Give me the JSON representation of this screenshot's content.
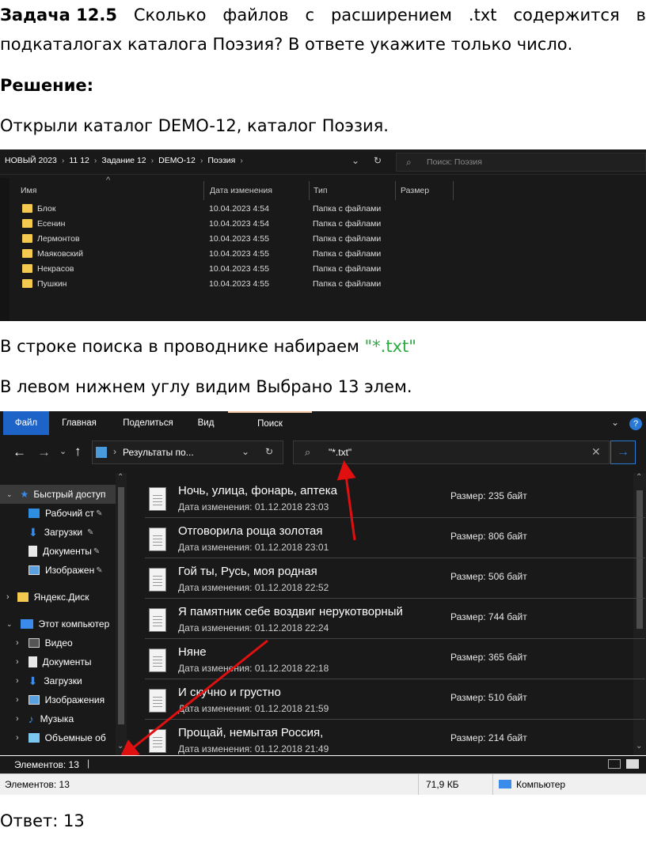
{
  "task": {
    "label": "Задача 12.5",
    "words": [
      "Сколько",
      "файлов",
      "с",
      "расширением",
      ".txt",
      "содержится",
      "в"
    ],
    "line2": "подкаталогах каталога Поэзия? В ответе укажите только число."
  },
  "solution_label": "Решение:",
  "step1": "Открыли каталог DEMO-12, каталог Поэзия.",
  "step2_prefix": "В строке поиска в проводнике набираем ",
  "step2_query": "\"*.txt\"",
  "step3": "В левом нижнем углу видим Выбрано 13 элем.",
  "answer": "Ответ: 13",
  "explorer1": {
    "breadcrumb": [
      "НОВЫЙ 2023",
      "11 12",
      "Задание 12",
      "DEMO-12",
      "Поэзия"
    ],
    "search_placeholder": "Поиск: Поэзия",
    "columns": [
      "Имя",
      "Дата изменения",
      "Тип",
      "Размер"
    ],
    "rows": [
      {
        "name": "Блок",
        "date": "10.04.2023 4:54",
        "type": "Папка с файлами"
      },
      {
        "name": "Есенин",
        "date": "10.04.2023 4:54",
        "type": "Папка с файлами"
      },
      {
        "name": "Лермонтов",
        "date": "10.04.2023 4:55",
        "type": "Папка с файлами"
      },
      {
        "name": "Маяковский",
        "date": "10.04.2023 4:55",
        "type": "Папка с файлами"
      },
      {
        "name": "Некрасов",
        "date": "10.04.2023 4:55",
        "type": "Папка с файлами"
      },
      {
        "name": "Пушкин",
        "date": "10.04.2023 4:55",
        "type": "Папка с файлами"
      }
    ],
    "colors": {
      "folder": "#f4c94f",
      "background": "#191919"
    }
  },
  "explorer2": {
    "tabs": [
      "Файл",
      "Главная",
      "Поделиться",
      "Вид",
      "Поиск"
    ],
    "address": "Результаты по...",
    "search_value": "\"*.txt\"",
    "sidebar": [
      {
        "label": "Быстрый доступ",
        "icon": "star-icon"
      },
      {
        "label": "Рабочий ст",
        "icon": "desktop-icon"
      },
      {
        "label": "Загрузки",
        "icon": "download-icon"
      },
      {
        "label": "Документы",
        "icon": "document-icon"
      },
      {
        "label": "Изображен",
        "icon": "image-icon"
      },
      {
        "label": "Яндекс.Диск",
        "icon": "yandex-disk-icon"
      },
      {
        "label": "Этот компьютер",
        "icon": "computer-icon"
      },
      {
        "label": "Видео",
        "icon": "video-icon"
      },
      {
        "label": "Документы",
        "icon": "document-icon"
      },
      {
        "label": "Загрузки",
        "icon": "download-icon"
      },
      {
        "label": "Изображения",
        "icon": "image-icon"
      },
      {
        "label": "Музыка",
        "icon": "music-icon"
      },
      {
        "label": "Объемные об",
        "icon": "cube-icon"
      }
    ],
    "results": [
      {
        "title": "Ночь, улица, фонарь, аптека",
        "date": "Дата изменения: 01.12.2018 23:03",
        "size": "Размер: 235 байт"
      },
      {
        "title": "Отговорила роща золотая",
        "date": "Дата изменения: 01.12.2018 23:01",
        "size": "Размер: 806 байт"
      },
      {
        "title": "Гой ты, Русь, моя родная",
        "date": "Дата изменения: 01.12.2018 22:52",
        "size": "Размер: 506 байт"
      },
      {
        "title": "Я памятник себе воздвиг нерукотворный",
        "date": "Дата изменения: 01.12.2018 22:24",
        "size": "Размер: 744 байт"
      },
      {
        "title": "Няне",
        "date": "Дата изменения: 01.12.2018 22:18",
        "size": "Размер: 365 байт"
      },
      {
        "title": "И скучно и грустно",
        "date": "Дата изменения: 01.12.2018 21:59",
        "size": "Размер: 510 байт"
      },
      {
        "title": "Прощай, немытая Россия,",
        "date": "Дата изменения: 01.12.2018 21:49",
        "size": "Размер: 214 байт"
      }
    ],
    "status_dark": "Элементов: 13",
    "status_light": {
      "count": "Элементов: 13",
      "size": "71,9 КБ",
      "location": "Компьютер"
    },
    "colors": {
      "file_tab": "#1e64c8",
      "arrow": "#e01010",
      "go_button": "#2a7ad5"
    }
  }
}
